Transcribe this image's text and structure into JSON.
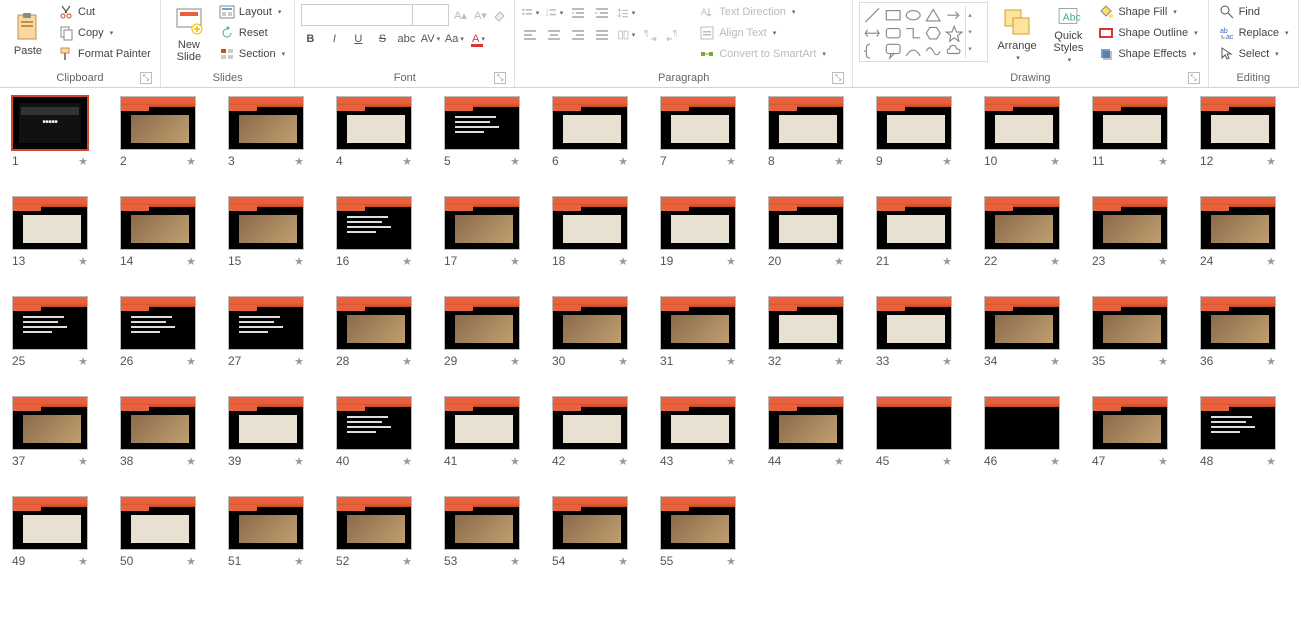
{
  "ribbon": {
    "clipboard": {
      "label": "Clipboard",
      "paste": "Paste",
      "cut": "Cut",
      "copy": "Copy",
      "format_painter": "Format Painter"
    },
    "slides": {
      "label": "Slides",
      "new_slide": "New\nSlide",
      "layout": "Layout",
      "reset": "Reset",
      "section": "Section"
    },
    "font": {
      "label": "Font",
      "name_placeholder": "",
      "size_placeholder": ""
    },
    "paragraph": {
      "label": "Paragraph",
      "text_direction": "Text Direction",
      "align_text": "Align Text",
      "convert_smartart": "Convert to SmartArt"
    },
    "drawing": {
      "label": "Drawing",
      "arrange": "Arrange",
      "quick_styles": "Quick\nStyles",
      "shape_fill": "Shape Fill",
      "shape_outline": "Shape Outline",
      "shape_effects": "Shape Effects"
    },
    "editing": {
      "label": "Editing",
      "find": "Find",
      "replace": "Replace",
      "select": "Select"
    }
  },
  "slides_data": {
    "selected": 1,
    "count": 55,
    "items": [
      {
        "n": 1,
        "t": "title"
      },
      {
        "n": 2,
        "t": "img"
      },
      {
        "n": 3,
        "t": "img"
      },
      {
        "n": 4,
        "t": "plan"
      },
      {
        "n": 5,
        "t": "text"
      },
      {
        "n": 6,
        "t": "plan"
      },
      {
        "n": 7,
        "t": "plan"
      },
      {
        "n": 8,
        "t": "plan"
      },
      {
        "n": 9,
        "t": "plan"
      },
      {
        "n": 10,
        "t": "plan"
      },
      {
        "n": 11,
        "t": "plan"
      },
      {
        "n": 12,
        "t": "plan"
      },
      {
        "n": 13,
        "t": "plan"
      },
      {
        "n": 14,
        "t": "img"
      },
      {
        "n": 15,
        "t": "img"
      },
      {
        "n": 16,
        "t": "text"
      },
      {
        "n": 17,
        "t": "img"
      },
      {
        "n": 18,
        "t": "plan"
      },
      {
        "n": 19,
        "t": "plan"
      },
      {
        "n": 20,
        "t": "plan"
      },
      {
        "n": 21,
        "t": "plan"
      },
      {
        "n": 22,
        "t": "img"
      },
      {
        "n": 23,
        "t": "img"
      },
      {
        "n": 24,
        "t": "img"
      },
      {
        "n": 25,
        "t": "text"
      },
      {
        "n": 26,
        "t": "text"
      },
      {
        "n": 27,
        "t": "text"
      },
      {
        "n": 28,
        "t": "img"
      },
      {
        "n": 29,
        "t": "img"
      },
      {
        "n": 30,
        "t": "img"
      },
      {
        "n": 31,
        "t": "img"
      },
      {
        "n": 32,
        "t": "plan"
      },
      {
        "n": 33,
        "t": "plan"
      },
      {
        "n": 34,
        "t": "img"
      },
      {
        "n": 35,
        "t": "img"
      },
      {
        "n": 36,
        "t": "img"
      },
      {
        "n": 37,
        "t": "img"
      },
      {
        "n": 38,
        "t": "img"
      },
      {
        "n": 39,
        "t": "plan"
      },
      {
        "n": 40,
        "t": "text"
      },
      {
        "n": 41,
        "t": "plan"
      },
      {
        "n": 42,
        "t": "plan"
      },
      {
        "n": 43,
        "t": "plan"
      },
      {
        "n": 44,
        "t": "img"
      },
      {
        "n": 45,
        "t": "blank"
      },
      {
        "n": 46,
        "t": "blank"
      },
      {
        "n": 47,
        "t": "img"
      },
      {
        "n": 48,
        "t": "text"
      },
      {
        "n": 49,
        "t": "plan"
      },
      {
        "n": 50,
        "t": "plan"
      },
      {
        "n": 51,
        "t": "img"
      },
      {
        "n": 52,
        "t": "img"
      },
      {
        "n": 53,
        "t": "img"
      },
      {
        "n": 54,
        "t": "img"
      },
      {
        "n": 55,
        "t": "img"
      }
    ]
  }
}
